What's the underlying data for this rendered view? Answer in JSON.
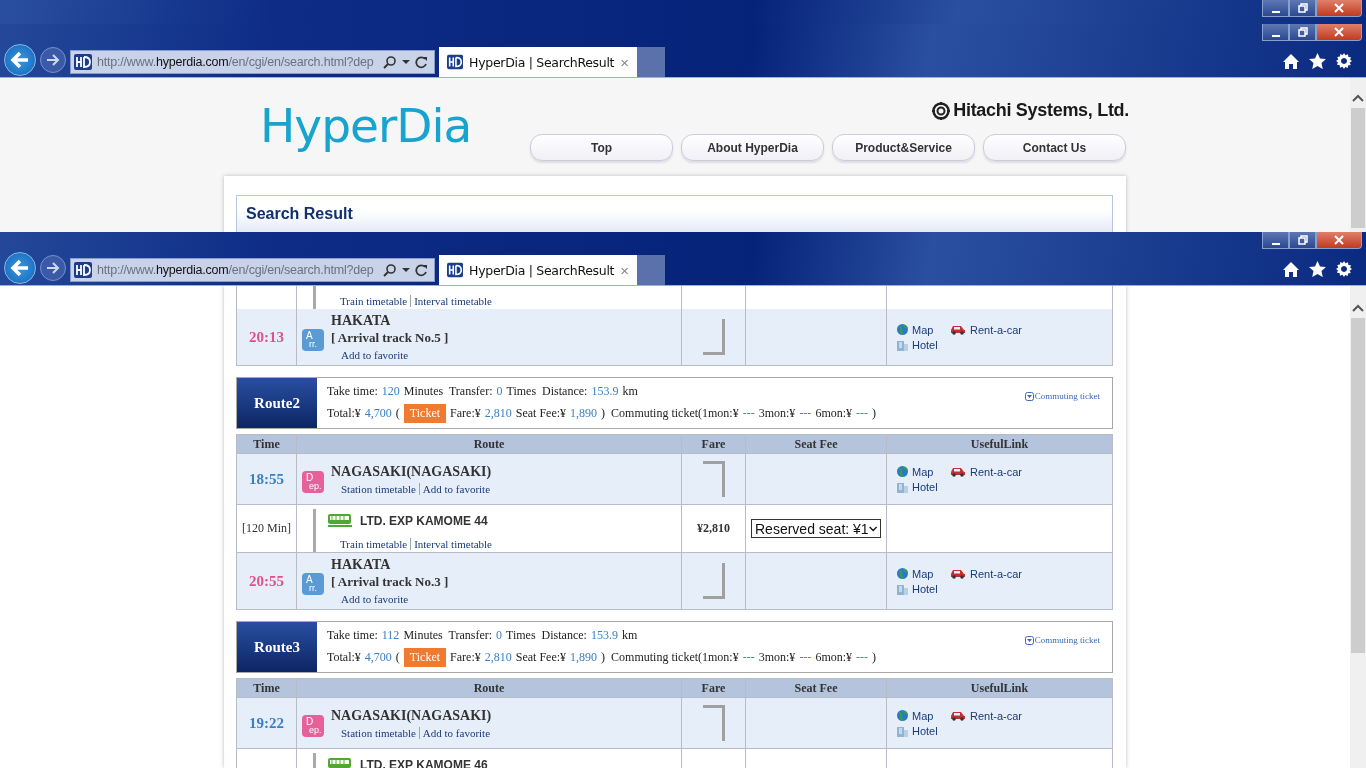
{
  "browsers": [
    {
      "url": {
        "prefix": "http://www.",
        "domain": "hyperdia.com",
        "path": "/en/cgi/en/search.html?dep"
      },
      "tab_title": "HyperDia | SearchResult",
      "tab_close": "×"
    },
    {
      "url": {
        "prefix": "http://www.",
        "domain": "hyperdia.com",
        "path": "/en/cgi/en/search.html?dep"
      },
      "tab_title": "HyperDia | SearchResult",
      "tab_close": "×"
    }
  ],
  "header": {
    "logo": "HyperDia",
    "company": "Hitachi Systems, Ltd.",
    "nav": [
      "Top",
      "About HyperDia",
      "Product&Service",
      "Contact Us"
    ],
    "section_title": "Search Result"
  },
  "routes": [
    {
      "rows": [
        {
          "kind": "leg",
          "links": [
            "Train timetable",
            "Interval timetable"
          ]
        },
        {
          "kind": "arr",
          "time": "20:13",
          "badge_top": "A",
          "badge_bottom": "rr.",
          "station": "HAKATA",
          "track": "[ Arrival track No.5 ]",
          "links": [
            "Add to favorite"
          ],
          "useful": [
            "Map",
            "Rent-a-car",
            "Hotel"
          ]
        }
      ]
    },
    {
      "label": "Route2",
      "commuting_link": "Commuting ticket",
      "line1": [
        {
          "kind": "label",
          "text": "Take time:"
        },
        {
          "kind": "value",
          "text": "120"
        },
        {
          "kind": "label",
          "text": "Minutes  Transfer:"
        },
        {
          "kind": "value",
          "text": "0"
        },
        {
          "kind": "label",
          "text": "Times  Distance:"
        },
        {
          "kind": "value",
          "text": "153.9"
        },
        {
          "kind": "label",
          "text": "km"
        }
      ],
      "line2": [
        {
          "kind": "label",
          "text": "Total:¥"
        },
        {
          "kind": "value",
          "text": "4,700"
        },
        {
          "kind": "label",
          "text": "("
        },
        {
          "kind": "badge",
          "text": "Ticket"
        },
        {
          "kind": "label",
          "text": "Fare:¥"
        },
        {
          "kind": "value",
          "text": "2,810"
        },
        {
          "kind": "label",
          "text": "Seat Fee:¥"
        },
        {
          "kind": "value",
          "text": "1,890"
        },
        {
          "kind": "label",
          "text": ")  Commuting ticket(1mon:¥"
        },
        {
          "kind": "value",
          "text": "---"
        },
        {
          "kind": "label",
          "text": "3mon:¥"
        },
        {
          "kind": "value",
          "text": "---"
        },
        {
          "kind": "label",
          "text": "6mon:¥"
        },
        {
          "kind": "value",
          "text": "---"
        },
        {
          "kind": "label",
          "text": ")"
        }
      ],
      "columns": [
        "Time",
        "Route",
        "Fare",
        "Seat Fee",
        "UsefulLink"
      ],
      "rows": [
        {
          "kind": "dep",
          "time": "18:55",
          "badge_top": "D",
          "badge_bottom": "ep.",
          "station": "NAGASAKI(NAGASAKI)",
          "links": [
            "Station timetable",
            "Add to favorite"
          ],
          "useful": [
            "Map",
            "Rent-a-car",
            "Hotel"
          ]
        },
        {
          "kind": "leg",
          "duration": "[120 Min]",
          "train": "LTD. EXP KAMOME 44",
          "links": [
            "Train timetable",
            "Interval timetable"
          ],
          "fare": "¥2,810",
          "seat": "Reserved seat: ¥1"
        },
        {
          "kind": "arr",
          "time": "20:55",
          "badge_top": "A",
          "badge_bottom": "rr.",
          "station": "HAKATA",
          "track": "[ Arrival track No.3 ]",
          "links": [
            "Add to favorite"
          ],
          "useful": [
            "Map",
            "Rent-a-car",
            "Hotel"
          ]
        }
      ]
    },
    {
      "label": "Route3",
      "commuting_link": "Commuting ticket",
      "line1": [
        {
          "kind": "label",
          "text": "Take time:"
        },
        {
          "kind": "value",
          "text": "112"
        },
        {
          "kind": "label",
          "text": "Minutes  Transfer:"
        },
        {
          "kind": "value",
          "text": "0"
        },
        {
          "kind": "label",
          "text": "Times  Distance:"
        },
        {
          "kind": "value",
          "text": "153.9"
        },
        {
          "kind": "label",
          "text": "km"
        }
      ],
      "line2": [
        {
          "kind": "label",
          "text": "Total:¥"
        },
        {
          "kind": "value",
          "text": "4,700"
        },
        {
          "kind": "label",
          "text": "("
        },
        {
          "kind": "badge",
          "text": "Ticket"
        },
        {
          "kind": "label",
          "text": "Fare:¥"
        },
        {
          "kind": "value",
          "text": "2,810"
        },
        {
          "kind": "label",
          "text": "Seat Fee:¥"
        },
        {
          "kind": "value",
          "text": "1,890"
        },
        {
          "kind": "label",
          "text": ")  Commuting ticket(1mon:¥"
        },
        {
          "kind": "value",
          "text": "---"
        },
        {
          "kind": "label",
          "text": "3mon:¥"
        },
        {
          "kind": "value",
          "text": "---"
        },
        {
          "kind": "label",
          "text": "6mon:¥"
        },
        {
          "kind": "value",
          "text": "---"
        },
        {
          "kind": "label",
          "text": ")"
        }
      ],
      "columns": [
        "Time",
        "Route",
        "Fare",
        "Seat Fee",
        "UsefulLink"
      ],
      "rows": [
        {
          "kind": "dep",
          "time": "19:22",
          "badge_top": "D",
          "badge_bottom": "ep.",
          "station": "NAGASAKI(NAGASAKI)",
          "links": [
            "Station timetable",
            "Add to favorite"
          ],
          "useful": [
            "Map",
            "Rent-a-car",
            "Hotel"
          ]
        },
        {
          "kind": "leg",
          "train": "LTD. EXP KAMOME 46"
        }
      ]
    }
  ]
}
